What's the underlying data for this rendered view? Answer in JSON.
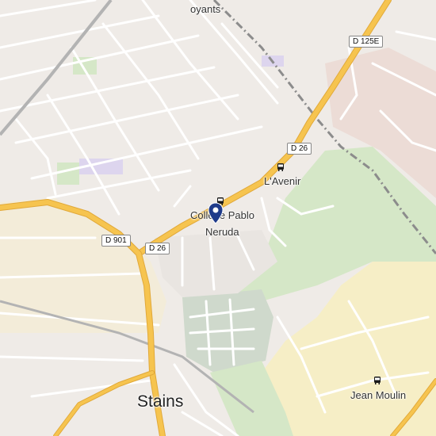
{
  "map": {
    "colors": {
      "background": "#efebe7",
      "industrial": "#f6eec6",
      "residential_block": "#e3dbd6",
      "park": "#d5e7c7",
      "cemetery": "#cfd9cc",
      "major_road": "#f6c44f",
      "minor_road": "#ffffff",
      "railway": "#8c8c8c",
      "marker": "#1f3b8a"
    },
    "labels": {
      "partial_top": "oyants",
      "city": "Stains",
      "poi_line1": "Collège Pablo",
      "poi_line2": "Neruda",
      "bus_avenir": "L'Avenir",
      "bus_jean_moulin": "Jean Moulin"
    },
    "road_shields": {
      "d125e": "D 125E",
      "d26_upper": "D 26",
      "d901": "D 901",
      "d26_lower": "D 26"
    },
    "icons": {
      "bus": "bus-stop-icon",
      "marker": "location-pin-icon"
    }
  }
}
